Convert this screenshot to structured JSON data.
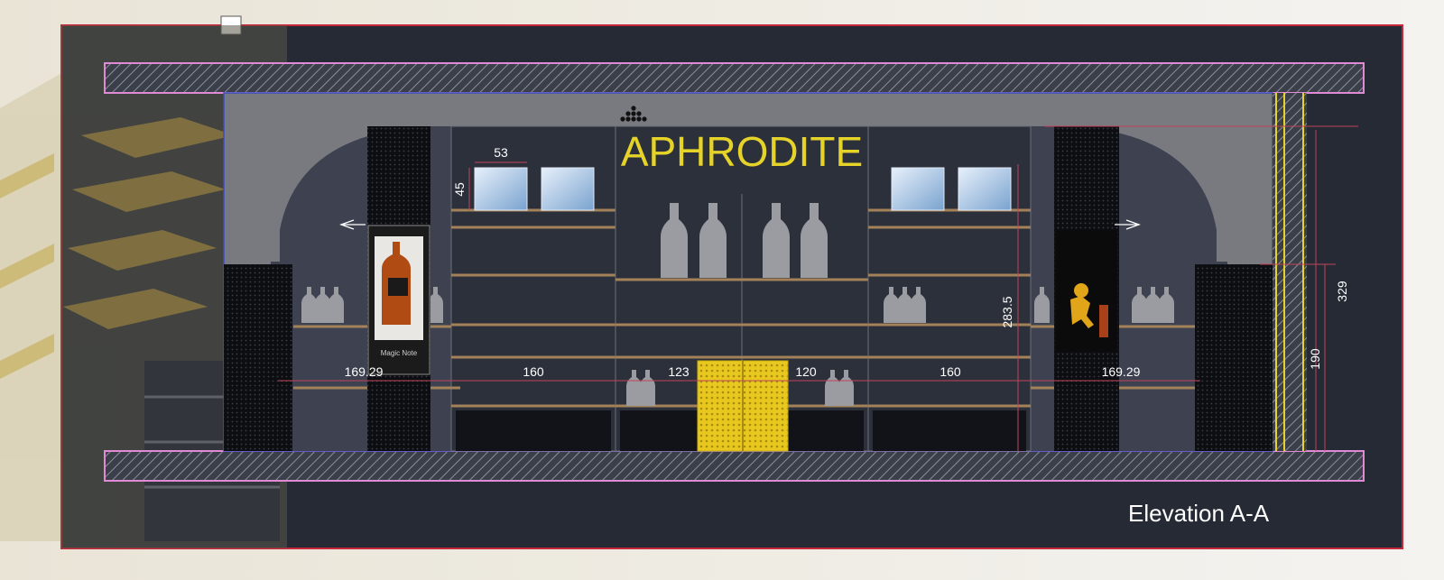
{
  "drawing": {
    "sign_text": "APHRODITE",
    "title": "Elevation A-A",
    "poster_left_caption": "Magic Note",
    "colors": {
      "frame_red": "#c8263a",
      "background": "#252a35",
      "slab_pink": "#e08ad6",
      "sign_yellow": "#e6d32a",
      "shelf_wood": "#a3825a",
      "dimension_red": "#c0455a"
    }
  },
  "dimensions": {
    "tile_width": "53",
    "tile_height": "45",
    "bottom": [
      "169.29",
      "160",
      "123",
      "120",
      "160",
      "169.29"
    ],
    "shelf_height": "283.5",
    "right_total": "329",
    "right_lower": "190"
  }
}
